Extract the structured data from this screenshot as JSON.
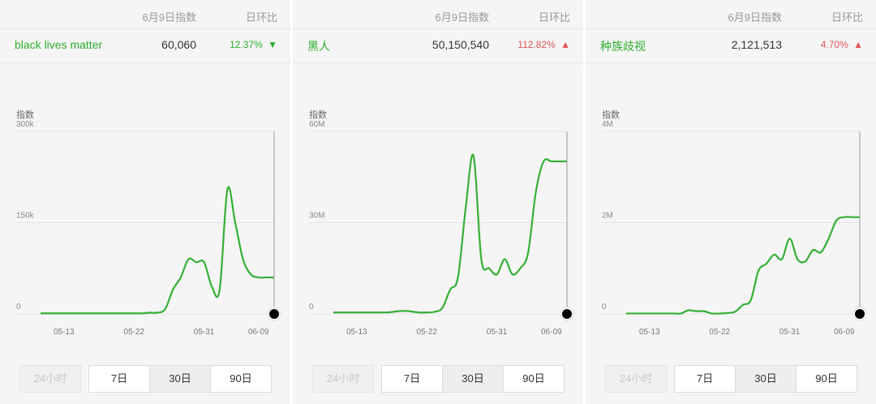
{
  "header": {
    "date_label": "6月9日指数",
    "ratio_label": "日环比"
  },
  "buttons": {
    "h24": "24小时",
    "d7": "7日",
    "d30": "30日",
    "d90": "90日",
    "active": "d30"
  },
  "colors": {
    "line": "#35b035",
    "up": "#e05555",
    "down": "#2fae2f"
  },
  "panels": [
    {
      "keyword": "black lives matter",
      "value": "60,060",
      "change": "12.37%",
      "direction": "down",
      "arrow": "▼"
    },
    {
      "keyword": "黑人",
      "value": "50,150,540",
      "change": "112.82%",
      "direction": "up",
      "arrow": "▲"
    },
    {
      "keyword": "种族歧视",
      "value": "2,121,513",
      "change": "4.70%",
      "direction": "up",
      "arrow": "▲"
    }
  ],
  "chart_data": [
    {
      "type": "line",
      "ylabel": "指数",
      "ylim": [
        0,
        300000
      ],
      "ytick_values": [
        0,
        150000,
        300000
      ],
      "ytick_labels": [
        "0",
        "150k",
        "300k"
      ],
      "xtick_indices": [
        3,
        12,
        21,
        28
      ],
      "xtick_labels": [
        "05-13",
        "05-22",
        "05-31",
        "06-09"
      ],
      "x": [
        "05-10",
        "05-11",
        "05-12",
        "05-13",
        "05-14",
        "05-15",
        "05-16",
        "05-17",
        "05-18",
        "05-19",
        "05-20",
        "05-21",
        "05-22",
        "05-23",
        "05-24",
        "05-25",
        "05-26",
        "05-27",
        "05-28",
        "05-29",
        "05-30",
        "05-31",
        "06-01",
        "06-02",
        "06-03",
        "06-04",
        "06-05",
        "06-06",
        "06-07",
        "06-08",
        "06-09"
      ],
      "series": [
        {
          "values": [
            1000,
            1000,
            1000,
            1000,
            1000,
            1000,
            1000,
            1000,
            1000,
            1000,
            1000,
            1000,
            1000,
            1000,
            2000,
            2000,
            8000,
            40000,
            60000,
            90000,
            85000,
            85000,
            45000,
            40000,
            205000,
            150000,
            90000,
            65000,
            60060,
            60060,
            60060
          ]
        }
      ],
      "grid": true
    },
    {
      "type": "line",
      "ylabel": "指数",
      "ylim": [
        0,
        60000000
      ],
      "ytick_values": [
        0,
        30000000,
        60000000
      ],
      "ytick_labels": [
        "0",
        "30M",
        "60M"
      ],
      "xtick_indices": [
        3,
        12,
        21,
        28
      ],
      "xtick_labels": [
        "05-13",
        "05-22",
        "05-31",
        "06-09"
      ],
      "x": [
        "05-10",
        "05-11",
        "05-12",
        "05-13",
        "05-14",
        "05-15",
        "05-16",
        "05-17",
        "05-18",
        "05-19",
        "05-20",
        "05-21",
        "05-22",
        "05-23",
        "05-24",
        "05-25",
        "05-26",
        "05-27",
        "05-28",
        "05-29",
        "05-30",
        "05-31",
        "06-01",
        "06-02",
        "06-03",
        "06-04",
        "06-05",
        "06-06",
        "06-07",
        "06-08",
        "06-09"
      ],
      "series": [
        {
          "values": [
            500000,
            500000,
            500000,
            500000,
            500000,
            500000,
            500000,
            500000,
            800000,
            1000000,
            800000,
            500000,
            500000,
            700000,
            2000000,
            8000000,
            12000000,
            35000000,
            52000000,
            18000000,
            15000000,
            13000000,
            18000000,
            13000000,
            15000000,
            20000000,
            40000000,
            50150540,
            50150540,
            50150540,
            50150540
          ]
        }
      ],
      "grid": true
    },
    {
      "type": "line",
      "ylabel": "指数",
      "ylim": [
        0,
        4000000
      ],
      "ytick_values": [
        0,
        2000000,
        4000000
      ],
      "ytick_labels": [
        "0",
        "2M",
        "4M"
      ],
      "xtick_indices": [
        3,
        12,
        21,
        28
      ],
      "xtick_labels": [
        "05-13",
        "05-22",
        "05-31",
        "06-09"
      ],
      "x": [
        "05-10",
        "05-11",
        "05-12",
        "05-13",
        "05-14",
        "05-15",
        "05-16",
        "05-17",
        "05-18",
        "05-19",
        "05-20",
        "05-21",
        "05-22",
        "05-23",
        "05-24",
        "05-25",
        "05-26",
        "05-27",
        "05-28",
        "05-29",
        "05-30",
        "05-31",
        "06-01",
        "06-02",
        "06-03",
        "06-04",
        "06-05",
        "06-06",
        "06-07",
        "06-08",
        "06-09"
      ],
      "series": [
        {
          "values": [
            10000,
            10000,
            10000,
            10000,
            10000,
            10000,
            10000,
            10000,
            80000,
            60000,
            60000,
            10000,
            10000,
            20000,
            50000,
            200000,
            300000,
            950000,
            1100000,
            1300000,
            1200000,
            1650000,
            1200000,
            1150000,
            1400000,
            1350000,
            1650000,
            2050000,
            2121513,
            2121513,
            2121513
          ]
        }
      ],
      "grid": true
    }
  ]
}
